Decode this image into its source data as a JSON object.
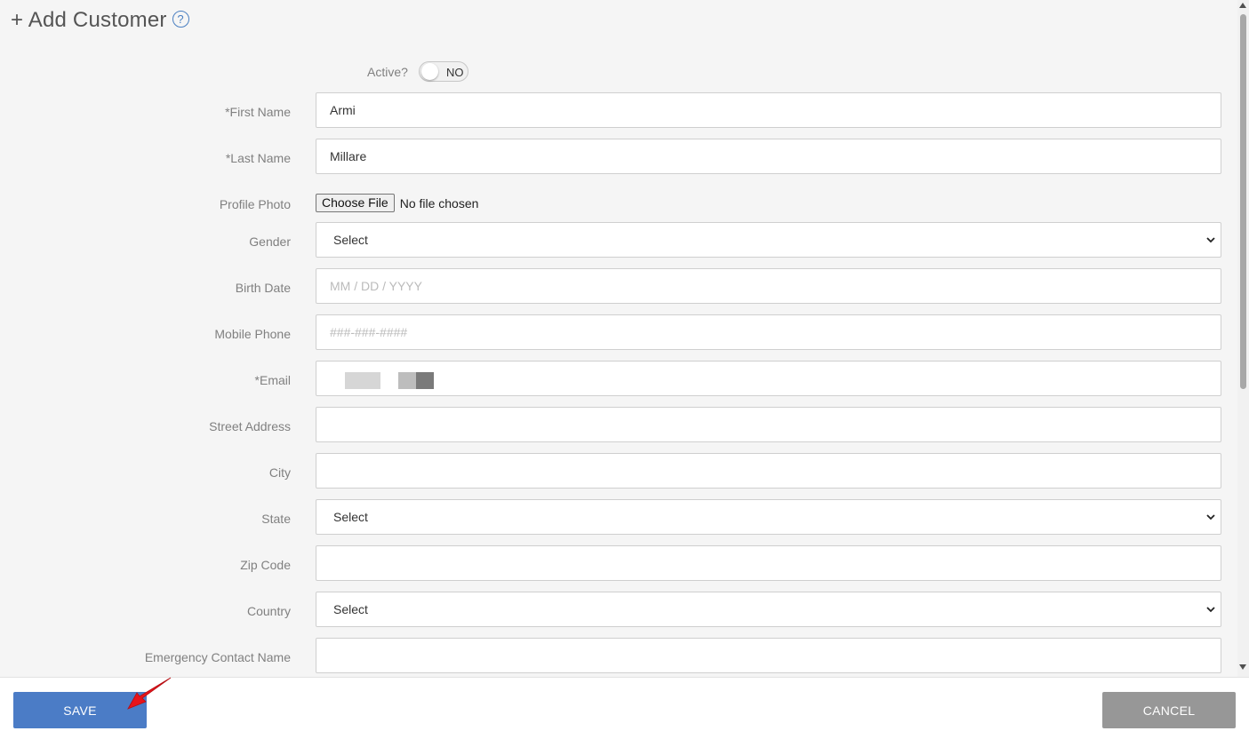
{
  "header": {
    "title": "+ Add Customer",
    "help_icon": "help-circle-icon"
  },
  "form": {
    "active": {
      "label": "Active?",
      "value": "NO",
      "enabled": false
    },
    "first_name": {
      "label": "*First Name",
      "value": "Armi"
    },
    "last_name": {
      "label": "*Last Name",
      "value": "Millare"
    },
    "profile_photo": {
      "label": "Profile Photo",
      "button": "Choose File",
      "status": "No file chosen"
    },
    "gender": {
      "label": "Gender",
      "value": "Select"
    },
    "birth_date": {
      "label": "Birth Date",
      "placeholder": "MM / DD / YYYY"
    },
    "mobile_phone": {
      "label": "Mobile Phone",
      "placeholder": "###-###-####"
    },
    "email": {
      "label": "*Email"
    },
    "street_address": {
      "label": "Street Address",
      "value": ""
    },
    "city": {
      "label": "City",
      "value": ""
    },
    "state": {
      "label": "State",
      "value": "Select"
    },
    "zip_code": {
      "label": "Zip Code",
      "value": ""
    },
    "country": {
      "label": "Country",
      "value": "Select"
    },
    "emergency_contact_name": {
      "label": "Emergency Contact Name",
      "value": ""
    }
  },
  "footer": {
    "save_label": "SAVE",
    "cancel_label": "CANCEL"
  },
  "colors": {
    "save": "#4b7cc6",
    "cancel": "#979797",
    "annotation_arrow": "#e8141b"
  }
}
